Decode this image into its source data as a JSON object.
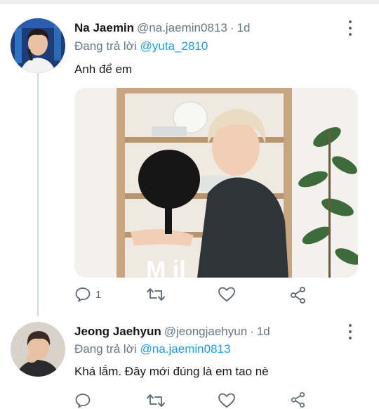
{
  "tweets": [
    {
      "name": "Na Jaemin",
      "handle": "@na.jaemin0813",
      "separator": "·",
      "time": "1d",
      "reply_prefix": "Đang trả lời",
      "reply_to": "@yuta_2810",
      "text": "Anh để em",
      "reply_count": "1",
      "media_overlay_text": "M  il"
    },
    {
      "name": "Jeong Jaehyun",
      "handle": "@jeongjaehyun",
      "separator": "·",
      "time": "1d",
      "reply_prefix": "Đang trả lời",
      "reply_to": "@na.jaemin0813",
      "text": "Khá lắm. Đây mới đúng là em tao nè"
    }
  ],
  "icons": {
    "reply": "comment-icon",
    "retweet": "retweet-icon",
    "like": "heart-icon",
    "share": "share-icon",
    "more": "more-vertical-icon"
  },
  "colors": {
    "mention": "#1d9bf0",
    "secondary_text": "#687684",
    "thread_line": "#cfd9de"
  }
}
